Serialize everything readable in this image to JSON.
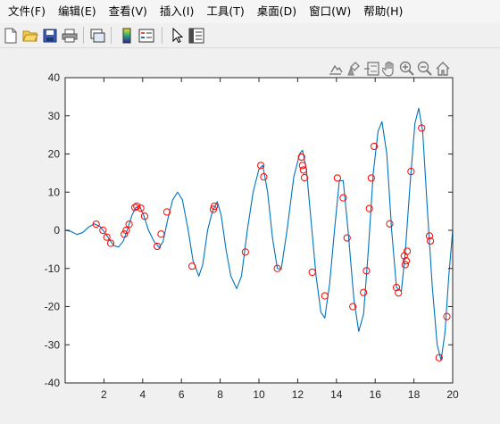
{
  "menu": {
    "items": [
      {
        "label": "文件(F)",
        "name": "menu-file"
      },
      {
        "label": "编辑(E)",
        "name": "menu-edit"
      },
      {
        "label": "查看(V)",
        "name": "menu-view"
      },
      {
        "label": "插入(I)",
        "name": "menu-insert"
      },
      {
        "label": "工具(T)",
        "name": "menu-tools"
      },
      {
        "label": "桌面(D)",
        "name": "menu-desktop"
      },
      {
        "label": "窗口(W)",
        "name": "menu-window"
      },
      {
        "label": "帮助(H)",
        "name": "menu-help"
      }
    ]
  },
  "toolbar": {
    "icons": [
      "new-figure-icon",
      "open-file-icon",
      "save-icon",
      "print-icon",
      "link-plot-icon",
      "insert-colorbar-icon",
      "insert-legend-icon",
      "pointer-icon",
      "property-inspector-icon"
    ]
  },
  "axes_toolbar": {
    "icons": [
      "export-icon",
      "brush-icon",
      "data-tips-icon",
      "pan-hand-icon",
      "zoom-in-icon",
      "zoom-out-icon",
      "home-icon"
    ]
  },
  "colors": {
    "line": "#0072bd",
    "markers": "#ff0000",
    "axes_background": "#ffffff",
    "figure_background": "#f0f0f0"
  },
  "chart_data": {
    "type": "line",
    "xlim": [
      0,
      20
    ],
    "ylim": [
      -40,
      40
    ],
    "xticks": [
      2,
      4,
      6,
      8,
      10,
      12,
      14,
      16,
      18,
      20
    ],
    "yticks": [
      -40,
      -30,
      -20,
      -10,
      0,
      10,
      20,
      30,
      40
    ],
    "grid": false,
    "legend": "none",
    "series": [
      {
        "style": "line",
        "color": "#0072bd",
        "points": [
          [
            0.0,
            0.0
          ],
          [
            0.3,
            -0.3
          ],
          [
            0.6,
            -1.1
          ],
          [
            0.9,
            -0.6
          ],
          [
            1.2,
            0.8
          ],
          [
            1.5,
            1.7
          ],
          [
            1.8,
            1.0
          ],
          [
            2.05,
            -0.6
          ],
          [
            2.3,
            -2.5
          ],
          [
            2.5,
            -4.0
          ],
          [
            2.75,
            -4.4
          ],
          [
            3.0,
            -2.8
          ],
          [
            3.2,
            0.0
          ],
          [
            3.45,
            4.0
          ],
          [
            3.65,
            6.0
          ],
          [
            3.85,
            6.2
          ],
          [
            4.05,
            4.0
          ],
          [
            4.3,
            0.0
          ],
          [
            4.6,
            -3.0
          ],
          [
            4.85,
            -4.5
          ],
          [
            5.05,
            -3.0
          ],
          [
            5.3,
            3.0
          ],
          [
            5.55,
            8.0
          ],
          [
            5.8,
            10.0
          ],
          [
            6.05,
            8.0
          ],
          [
            6.35,
            0.0
          ],
          [
            6.6,
            -8.0
          ],
          [
            6.9,
            -12.0
          ],
          [
            7.1,
            -9.0
          ],
          [
            7.35,
            0.0
          ],
          [
            7.6,
            5.0
          ],
          [
            7.85,
            7.5
          ],
          [
            8.05,
            4.0
          ],
          [
            8.3,
            -5.0
          ],
          [
            8.55,
            -12.0
          ],
          [
            8.85,
            -15.3
          ],
          [
            9.1,
            -12.0
          ],
          [
            9.4,
            0.0
          ],
          [
            9.7,
            10.0
          ],
          [
            10.0,
            16.0
          ],
          [
            10.2,
            17.0
          ],
          [
            10.45,
            10.0
          ],
          [
            10.7,
            -2.0
          ],
          [
            10.95,
            -10.0
          ],
          [
            11.15,
            -10.2
          ],
          [
            11.45,
            0.0
          ],
          [
            11.8,
            14.0
          ],
          [
            12.1,
            20.0
          ],
          [
            12.25,
            21.0
          ],
          [
            12.45,
            16.0
          ],
          [
            12.7,
            2.0
          ],
          [
            12.95,
            -12.0
          ],
          [
            13.2,
            -21.5
          ],
          [
            13.4,
            -23.0
          ],
          [
            13.65,
            -14.0
          ],
          [
            13.9,
            0.0
          ],
          [
            14.15,
            13.0
          ],
          [
            14.35,
            13.0
          ],
          [
            14.6,
            0.0
          ],
          [
            14.9,
            -18.0
          ],
          [
            15.15,
            -26.5
          ],
          [
            15.4,
            -22.0
          ],
          [
            15.65,
            -5.0
          ],
          [
            15.9,
            15.0
          ],
          [
            16.15,
            26.0
          ],
          [
            16.35,
            28.5
          ],
          [
            16.6,
            20.0
          ],
          [
            16.85,
            0.0
          ],
          [
            17.1,
            -15.0
          ],
          [
            17.35,
            -16.0
          ],
          [
            17.55,
            -6.0
          ],
          [
            17.8,
            12.0
          ],
          [
            18.05,
            28.0
          ],
          [
            18.25,
            32.0
          ],
          [
            18.45,
            26.0
          ],
          [
            18.7,
            5.0
          ],
          [
            18.95,
            -15.0
          ],
          [
            19.2,
            -30.0
          ],
          [
            19.4,
            -34.0
          ],
          [
            19.6,
            -27.0
          ],
          [
            19.8,
            -12.0
          ],
          [
            20.0,
            0.0
          ]
        ]
      },
      {
        "style": "markers",
        "marker": "circle",
        "color": "#ff0000",
        "points": [
          [
            1.6,
            1.6
          ],
          [
            1.95,
            0.0
          ],
          [
            2.15,
            -1.8
          ],
          [
            2.35,
            -3.4
          ],
          [
            3.05,
            -1.0
          ],
          [
            3.15,
            0.0
          ],
          [
            3.3,
            1.6
          ],
          [
            3.6,
            6.0
          ],
          [
            3.7,
            6.3
          ],
          [
            3.9,
            5.8
          ],
          [
            4.1,
            3.7
          ],
          [
            4.75,
            -4.2
          ],
          [
            4.95,
            -1.0
          ],
          [
            5.25,
            4.8
          ],
          [
            6.55,
            -9.4
          ],
          [
            7.65,
            5.5
          ],
          [
            7.7,
            6.3
          ],
          [
            9.3,
            -5.7
          ],
          [
            10.1,
            17.0
          ],
          [
            10.25,
            14.0
          ],
          [
            10.95,
            -10.0
          ],
          [
            12.2,
            19.2
          ],
          [
            12.25,
            17.0
          ],
          [
            12.3,
            15.8
          ],
          [
            12.35,
            13.8
          ],
          [
            12.75,
            -11.0
          ],
          [
            13.4,
            -17.2
          ],
          [
            14.05,
            13.7
          ],
          [
            14.35,
            8.5
          ],
          [
            14.55,
            -2.0
          ],
          [
            14.85,
            -20.0
          ],
          [
            15.4,
            -16.3
          ],
          [
            15.55,
            -10.6
          ],
          [
            15.7,
            5.7
          ],
          [
            15.8,
            13.7
          ],
          [
            15.95,
            22.0
          ],
          [
            16.75,
            1.7
          ],
          [
            17.1,
            -15.0
          ],
          [
            17.2,
            -16.4
          ],
          [
            17.5,
            -6.7
          ],
          [
            17.55,
            -9.0
          ],
          [
            17.6,
            -8.0
          ],
          [
            17.65,
            -5.5
          ],
          [
            17.85,
            15.4
          ],
          [
            18.4,
            26.8
          ],
          [
            18.8,
            -1.5
          ],
          [
            18.85,
            -2.8
          ],
          [
            19.3,
            -33.4
          ],
          [
            19.7,
            -22.6
          ]
        ]
      }
    ]
  }
}
